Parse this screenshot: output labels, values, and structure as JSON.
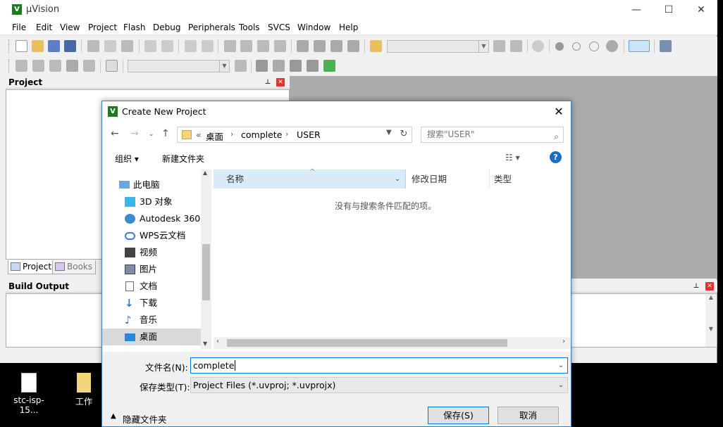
{
  "app": {
    "title": "µVision",
    "logo": "V"
  },
  "window_controls": {
    "minimize": "—",
    "maximize": "☐",
    "close": "✕"
  },
  "menu": [
    "File",
    "Edit",
    "View",
    "Project",
    "Flash",
    "Debug",
    "Peripherals",
    "Tools",
    "SVCS",
    "Window",
    "Help"
  ],
  "project_panel": {
    "title": "Project",
    "tabs": [
      "Project",
      "Books"
    ]
  },
  "build_output": {
    "title": "Build Output"
  },
  "desktop_icons": [
    {
      "label": "stc-isp-15...",
      "icon": "pdf-file-icon"
    },
    {
      "label": "工作",
      "icon": "folder-icon"
    }
  ],
  "dialog": {
    "title": "Create New Project",
    "logo": "V",
    "breadcrumb": {
      "prefix": "«",
      "items": [
        "桌面",
        "complete",
        "USER"
      ]
    },
    "search_placeholder": "搜索\"USER\"",
    "commands": {
      "organize": "组织 ▾",
      "new_folder": "新建文件夹"
    },
    "help": "?",
    "nav_tree": [
      {
        "label": "此电脑",
        "icon": "computer-icon",
        "indent": 0
      },
      {
        "label": "3D 对象",
        "icon": "3d-objects-icon",
        "indent": 1
      },
      {
        "label": "Autodesk 360",
        "icon": "autodesk-icon",
        "indent": 1
      },
      {
        "label": "WPS云文档",
        "icon": "cloud-icon",
        "indent": 1
      },
      {
        "label": "视频",
        "icon": "video-icon",
        "indent": 1
      },
      {
        "label": "图片",
        "icon": "picture-icon",
        "indent": 1
      },
      {
        "label": "文档",
        "icon": "document-icon",
        "indent": 1
      },
      {
        "label": "下载",
        "icon": "download-icon",
        "indent": 1
      },
      {
        "label": "音乐",
        "icon": "music-icon",
        "indent": 1
      },
      {
        "label": "桌面",
        "icon": "desktop-icon",
        "indent": 1,
        "selected": true
      }
    ],
    "columns": [
      "名称",
      "修改日期",
      "类型"
    ],
    "empty_message": "没有与搜索条件匹配的项。",
    "filename_label": "文件名(N):",
    "filename_value": "complete",
    "filetype_label": "保存类型(T):",
    "filetype_value": "Project Files (*.uvproj; *.uvprojx)",
    "hide_folders": "隐藏文件夹",
    "save_button": "保存(S)",
    "cancel_button": "取消"
  },
  "colors": {
    "accent": "#0078d7",
    "logo_green": "#1e7a1e",
    "selected_bg": "#cce8ff",
    "header_bg": "#d9ebf9"
  }
}
